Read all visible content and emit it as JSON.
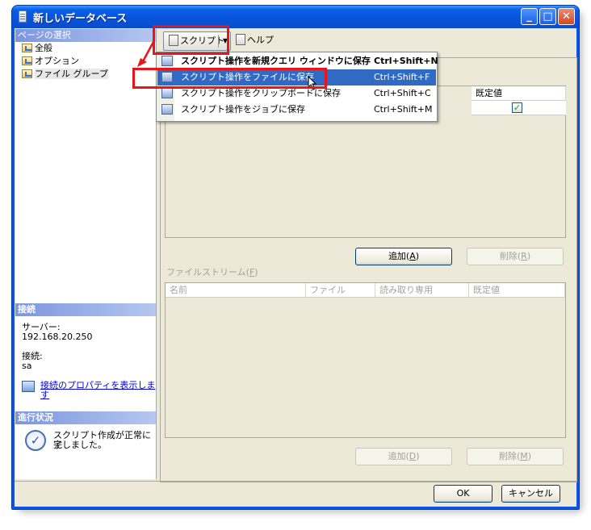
{
  "window": {
    "title": "新しいデータベース"
  },
  "left": {
    "page_select_header": "ページの選択",
    "pages": [
      {
        "label": "全般"
      },
      {
        "label": "オプション"
      },
      {
        "label": "ファイル グループ"
      }
    ],
    "connection_header": "接続",
    "server_label": "サーバー:",
    "server_value": "192.168.20.250",
    "connection_label": "接続:",
    "connection_value": "sa",
    "connection_link_line1": "接続のプロパティを表示しま",
    "connection_link_line2": "す",
    "progress_header": "進行状況",
    "progress_line1": "スクリプト作成が正常に完",
    "progress_line2": "了しました。"
  },
  "toolbar": {
    "script_label": "スクリプト",
    "help_label": "ヘルプ"
  },
  "menu": {
    "items": [
      {
        "label": "スクリプト操作を新規クエリ ウィンドウに保存",
        "shortcut": "Ctrl+Shift+N"
      },
      {
        "label": "スクリプト操作をファイルに保存",
        "shortcut": "Ctrl+Shift+F"
      },
      {
        "label": "スクリプト操作をクリップボードに保存",
        "shortcut": "Ctrl+Shift+C"
      },
      {
        "label": "スクリプト操作をジョブに保存",
        "shortcut": "Ctrl+Shift+M"
      }
    ]
  },
  "filegroups": {
    "default_header": "既定値",
    "default_checked": true,
    "add_label": "追加(",
    "add_key": "A",
    "delete_label": "削除(",
    "delete_key": "R"
  },
  "filestream": {
    "section_label": "ファイルストリーム(",
    "section_key": "F",
    "columns": [
      "名前",
      "ファイル",
      "読み取り専用",
      "既定値"
    ],
    "add_label": "追加(",
    "add_key": "D",
    "delete_label": "削除(",
    "delete_key": "M"
  },
  "footer": {
    "ok_label": "OK",
    "cancel_label": "キャンセル"
  },
  "colors": {
    "titlebar": "#0a55e6",
    "highlight": "#316ac5",
    "annotation_red": "#e8161a"
  }
}
